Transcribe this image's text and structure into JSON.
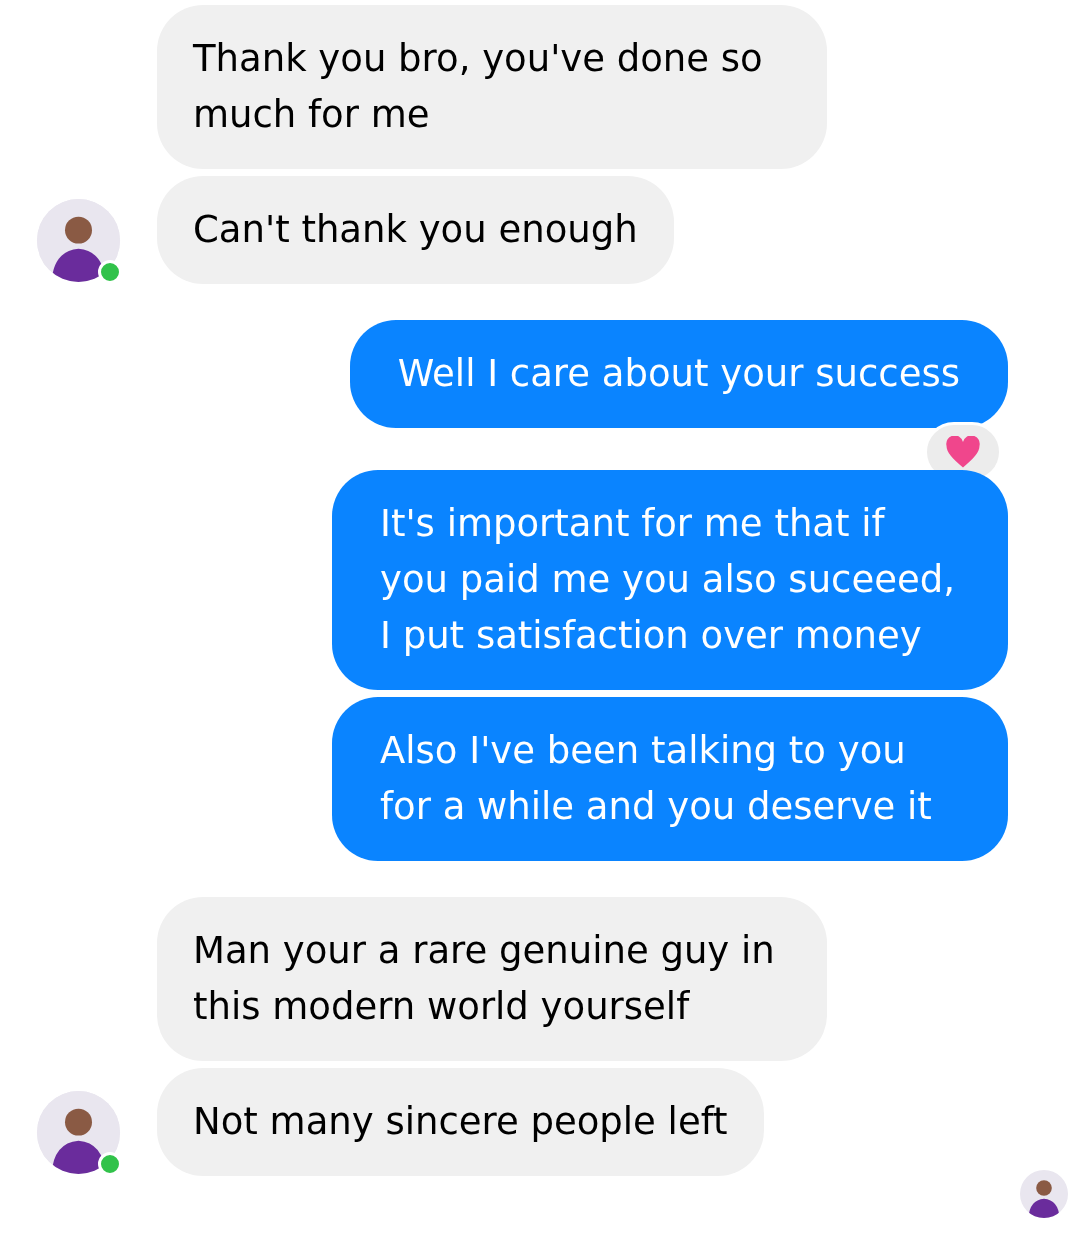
{
  "groups": [
    {
      "outgoing": false,
      "online": true,
      "messages": [
        {
          "text": "Thank you bro, you've done so much for me",
          "reacted": false
        },
        {
          "text": "Can't thank you enough",
          "reacted": false
        }
      ]
    },
    {
      "outgoing": true,
      "messages": [
        {
          "text": "Well I care about your success",
          "reacted": true
        }
      ]
    },
    {
      "outgoing": true,
      "messages": [
        {
          "text": "It's important for me that if you paid me you also suceeed, I put satisfaction over money",
          "reacted": false
        },
        {
          "text": "Also I've been talking to you for a while and you deserve it",
          "reacted": false
        }
      ]
    },
    {
      "outgoing": false,
      "online": true,
      "messages": [
        {
          "text": "Man your a rare genuine guy in this modern world yourself",
          "reacted": false
        },
        {
          "text": "Not many sincere people left",
          "reacted": false
        }
      ]
    }
  ],
  "seen": true
}
